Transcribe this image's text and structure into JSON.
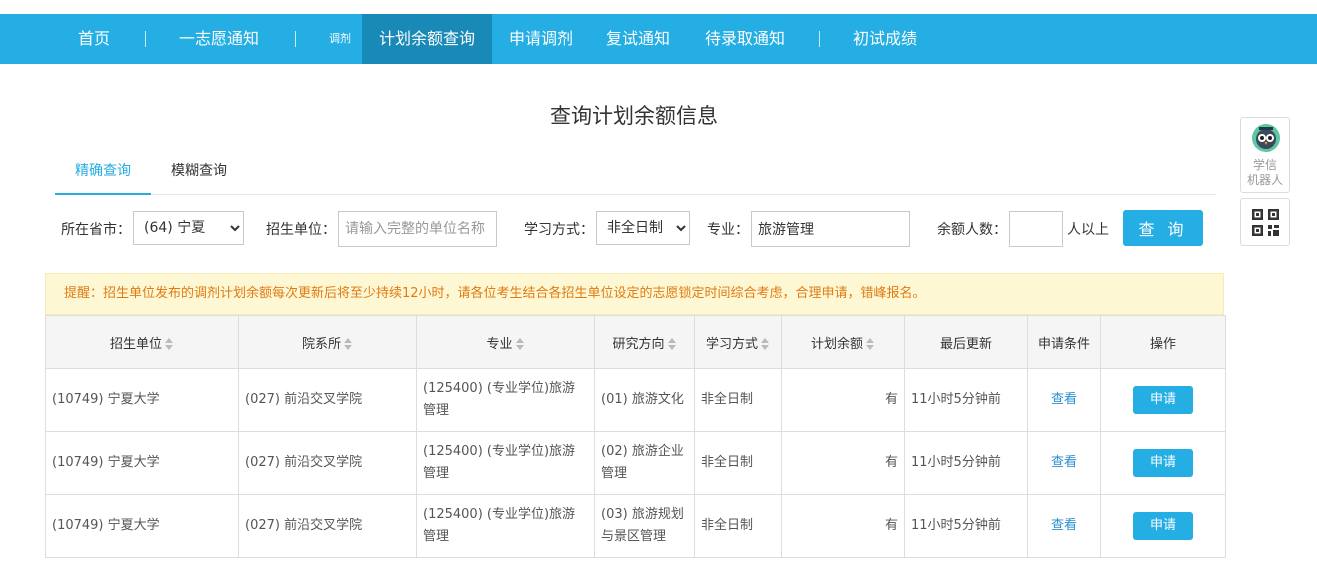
{
  "nav": {
    "home": "首页",
    "first_choice": "一志愿通知",
    "adjust_tag": "调剂",
    "plan_query": "计划余额查询",
    "apply_adjust": "申请调剂",
    "retest": "复试通知",
    "admission": "待录取通知",
    "prelim_score": "初试成绩"
  },
  "page_title": "查询计划余额信息",
  "tabs": {
    "exact": "精确查询",
    "fuzzy": "模糊查询"
  },
  "filters": {
    "province_label": "所在省市：",
    "province_value": "(64) 宁夏",
    "unit_label": "招生单位：",
    "unit_placeholder": "请输入完整的单位名称",
    "study_label": "学习方式：",
    "study_value": "非全日制",
    "major_label": "专业：",
    "major_value": "旅游管理",
    "remain_label": "余额人数：",
    "remain_value": "",
    "remain_suffix": "人以上",
    "query_button": "查 询"
  },
  "notice": "提醒：招生单位发布的调剂计划余额每次更新后将至少持续12小时，请各位考生结合各招生单位设定的志愿锁定时间综合考虑，合理申请，错峰报名。",
  "table": {
    "headers": [
      "招生单位",
      "院系所",
      "专业",
      "研究方向",
      "学习方式",
      "计划余额",
      "最后更新",
      "申请条件",
      "操作"
    ],
    "rows": [
      {
        "unit": "(10749) 宁夏大学",
        "dept": "(027) 前沿交叉学院",
        "major": "(125400) (专业学位)旅游管理",
        "direction": "(01) 旅游文化",
        "mode": "非全日制",
        "remain": "有",
        "updated": "11小时5分钟前",
        "condition": "查看",
        "action": "申请"
      },
      {
        "unit": "(10749) 宁夏大学",
        "dept": "(027) 前沿交叉学院",
        "major": "(125400) (专业学位)旅游管理",
        "direction": "(02) 旅游企业管理",
        "mode": "非全日制",
        "remain": "有",
        "updated": "11小时5分钟前",
        "condition": "查看",
        "action": "申请"
      },
      {
        "unit": "(10749) 宁夏大学",
        "dept": "(027) 前沿交叉学院",
        "major": "(125400) (专业学位)旅游管理",
        "direction": "(03) 旅游规划与景区管理",
        "mode": "非全日制",
        "remain": "有",
        "updated": "11小时5分钟前",
        "condition": "查看",
        "action": "申请"
      }
    ]
  },
  "side": {
    "robot_line1": "学信",
    "robot_line2": "机器人"
  },
  "colors": {
    "primary": "#24aee4",
    "nav_active": "#1989b8",
    "link": "#2a8fd0",
    "notice_bg": "#fdf7d3",
    "notice_text": "#e07b13"
  }
}
